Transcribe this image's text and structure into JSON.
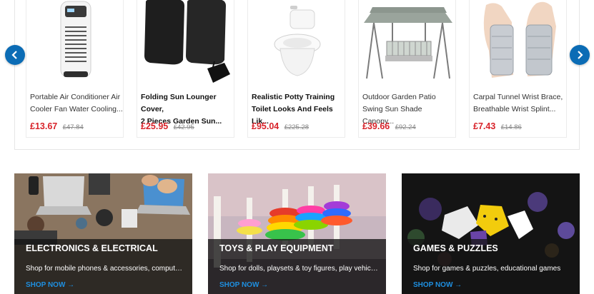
{
  "carousel": {
    "prev_icon": "chevron-left-icon",
    "next_icon": "chevron-right-icon",
    "accent": "#0b6cb5",
    "products": [
      {
        "name_line1": "Portable Air Conditioner Air",
        "name_line2": "Cooler Fan Water Cooling...",
        "price": "£13.67",
        "old_price": "£47.84"
      },
      {
        "name_line1": "Folding Sun Lounger Cover,",
        "name_line2": "2 Pieces Garden Sun...",
        "price": "£25.95",
        "old_price": "£42.95"
      },
      {
        "name_line1": "Realistic Potty Training",
        "name_line2": "Toilet Looks And Feels Lik...",
        "price": "£95.04",
        "old_price": "£225.28"
      },
      {
        "name_line1": "Outdoor Garden Patio",
        "name_line2": "Swing Sun Shade Canopy...",
        "price": "£39.66",
        "old_price": "£92.24"
      },
      {
        "name_line1": "Carpal Tunnel Wrist Brace,",
        "name_line2": "Breathable Wrist Splint...",
        "price": "£7.43",
        "old_price": "£14.86"
      }
    ]
  },
  "categories": [
    {
      "title": "ELECTRONICS & ELECTRICAL",
      "desc": "Shop for mobile phones & accessories, computers & laptops",
      "cta": "SHOP NOW →"
    },
    {
      "title": "TOYS & PLAY EQUIPMENT",
      "desc": "Shop for dolls, playsets & toy figures, play vehicles",
      "cta": "SHOP NOW →"
    },
    {
      "title": "GAMES & PUZZLES",
      "desc": "Shop for games & puzzles, educational games",
      "cta": "SHOP NOW →"
    }
  ],
  "colors": {
    "price": "#d8232a",
    "cta": "#1e8fe0"
  }
}
